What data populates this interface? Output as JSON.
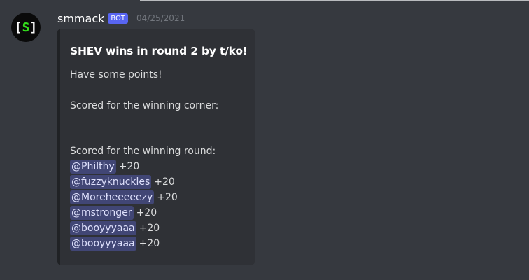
{
  "message": {
    "avatar": {
      "left_bracket": "[",
      "letter": "S",
      "right_bracket": "]"
    },
    "username": "smmack",
    "bot_tag": "BOT",
    "timestamp": "04/25/2021",
    "embed": {
      "title": "SHEV wins in round 2 by t/ko!",
      "description": "Have some points!",
      "corner_heading": "Scored for the winning corner:",
      "round_heading": "Scored for the winning round:",
      "round_scores": [
        {
          "mention": "@Philthy",
          "points": "+20"
        },
        {
          "mention": "@fuzzyknuckles",
          "points": "+20"
        },
        {
          "mention": "@Moreheeeeezy",
          "points": "+20"
        },
        {
          "mention": "@mstronger",
          "points": "+20"
        },
        {
          "mention": "@booyyyaaa",
          "points": "+20"
        },
        {
          "mention": "@booyyyaaa",
          "points": "+20"
        }
      ]
    }
  },
  "colors": {
    "background": "#36393f",
    "embed_background": "#2f3136",
    "bot_tag": "#5865f2",
    "mention_background": "#414675",
    "avatar_letter": "#34e01c"
  }
}
